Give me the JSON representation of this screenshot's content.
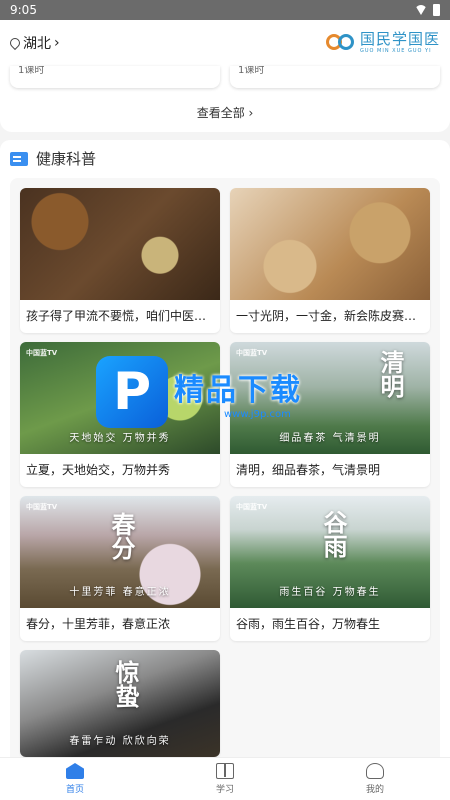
{
  "status": {
    "time": "9:05"
  },
  "header": {
    "location": "湖北",
    "chevron": "›",
    "logo_cn": "国民学国医",
    "logo_en": "GUO MIN XUE GUO YI"
  },
  "top_cards": [
    {
      "label": "1课时"
    },
    {
      "label": "1课时"
    }
  ],
  "see_all": "查看全部 ›",
  "section": {
    "title": "健康科普"
  },
  "cards": [
    {
      "caption": "孩子得了甲流不要慌，咱们中医…",
      "overlay": "",
      "sub": "",
      "channel": ""
    },
    {
      "caption": "一寸光阴，一寸金，新会陈皮赛…",
      "overlay": "",
      "sub": "",
      "channel": ""
    },
    {
      "caption": "立夏，天地始交，万物并秀",
      "overlay": "",
      "sub": "天地始交  万物并秀",
      "channel": "中国蓝TV"
    },
    {
      "caption": "清明，细品春茶，气清景明",
      "overlay": "清明",
      "sub": "细品春茶  气清景明",
      "channel": "中国蓝TV"
    },
    {
      "caption": "春分，十里芳菲，春意正浓",
      "overlay": "春分",
      "sub": "十里芳菲  春意正浓",
      "channel": "中国蓝TV"
    },
    {
      "caption": "谷雨，雨生百谷，万物春生",
      "overlay": "谷雨",
      "sub": "雨生百谷  万物春生",
      "channel": "中国蓝TV"
    },
    {
      "caption": "",
      "overlay": "惊蛰",
      "sub": "春雷乍动  欣欣向荣",
      "channel": ""
    }
  ],
  "watermark": {
    "cn": "精品下载",
    "url": "www.j9p.com",
    "letter": "P"
  },
  "tabs": [
    {
      "label": "首页",
      "icon": "home-icon"
    },
    {
      "label": "学习",
      "icon": "book-icon"
    },
    {
      "label": "我的",
      "icon": "user-icon"
    }
  ]
}
